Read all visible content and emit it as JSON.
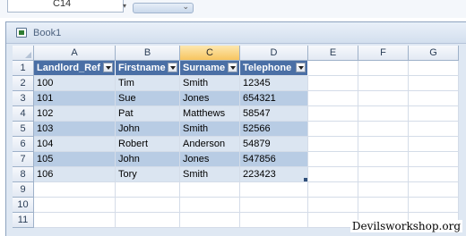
{
  "formula_bar": {
    "name_box": "C14"
  },
  "window": {
    "title": "Book1"
  },
  "columns": [
    "A",
    "B",
    "C",
    "D",
    "E",
    "F",
    "G"
  ],
  "selected_column": "C",
  "rows": [
    "1",
    "2",
    "3",
    "4",
    "5",
    "6",
    "7",
    "8",
    "9",
    "10",
    "11"
  ],
  "table": {
    "headers": [
      "Landlord_Ref",
      "Firstname",
      "Surname",
      "Telephone"
    ],
    "data": [
      [
        "100",
        "Tim",
        "Smith",
        "12345"
      ],
      [
        "101",
        "Sue",
        "Jones",
        "654321"
      ],
      [
        "102",
        "Pat",
        "Matthews",
        "58547"
      ],
      [
        "103",
        "John",
        "Smith",
        "52566"
      ],
      [
        "104",
        "Robert",
        "Anderson",
        "54879"
      ],
      [
        "105",
        "John",
        "Jones",
        "547856"
      ],
      [
        "106",
        "Tory",
        "Smith",
        "223423"
      ]
    ]
  },
  "colors": {
    "header_row": "#4a6fa5",
    "band_light": "#dbe5f1",
    "band_dark": "#b8cce4",
    "selected_column_header": "#f7c55f"
  },
  "watermark": "Devilsworkshop.org"
}
